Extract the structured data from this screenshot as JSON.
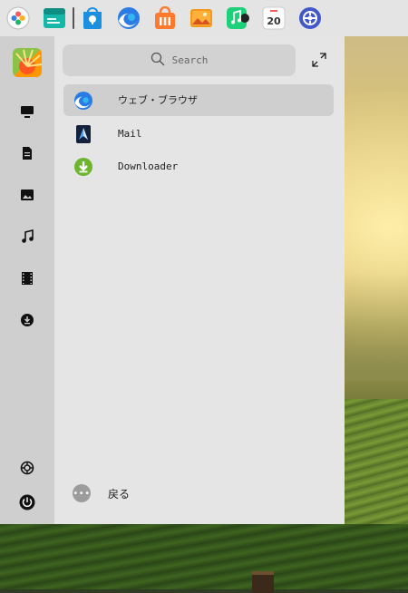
{
  "dock": {
    "items": [
      {
        "name": "launcher",
        "icon": "launcher-icon"
      },
      {
        "name": "files",
        "icon": "file-manager-icon"
      },
      {
        "name": "app-store",
        "icon": "app-store-icon"
      },
      {
        "name": "browser",
        "icon": "browser-icon"
      },
      {
        "name": "store",
        "icon": "shopping-bag-icon"
      },
      {
        "name": "photos",
        "icon": "photos-icon"
      },
      {
        "name": "music",
        "icon": "music-icon"
      },
      {
        "name": "calendar",
        "icon": "calendar-icon",
        "day": "20"
      },
      {
        "name": "settings",
        "icon": "settings-icon"
      }
    ]
  },
  "sidebar": {
    "items": [
      {
        "name": "computer",
        "icon": "monitor-icon"
      },
      {
        "name": "documents",
        "icon": "document-icon"
      },
      {
        "name": "pictures",
        "icon": "picture-icon"
      },
      {
        "name": "music",
        "icon": "music-note-icon"
      },
      {
        "name": "videos",
        "icon": "film-icon"
      },
      {
        "name": "downloads",
        "icon": "download-icon"
      }
    ],
    "bottom": [
      {
        "name": "settings",
        "icon": "gear-icon"
      },
      {
        "name": "power",
        "icon": "power-icon"
      }
    ]
  },
  "search": {
    "placeholder": "Search"
  },
  "apps": [
    {
      "label": "ウェブ・ブラウザ",
      "icon": "browser-icon",
      "selected": true
    },
    {
      "label": "Mail",
      "icon": "mail-icon",
      "selected": false
    },
    {
      "label": "Downloader",
      "icon": "downloader-icon",
      "selected": false
    }
  ],
  "back": {
    "label": "戻る"
  },
  "colors": {
    "accent": "#3a8ee6",
    "download_green": "#6cb52d"
  }
}
